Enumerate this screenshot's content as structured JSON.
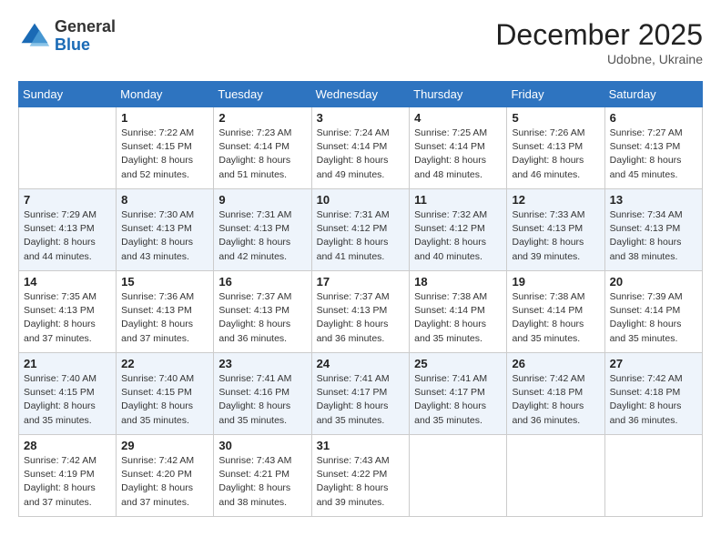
{
  "header": {
    "logo_general": "General",
    "logo_blue": "Blue",
    "month_title": "December 2025",
    "location": "Udobne, Ukraine"
  },
  "days_of_week": [
    "Sunday",
    "Monday",
    "Tuesday",
    "Wednesday",
    "Thursday",
    "Friday",
    "Saturday"
  ],
  "weeks": [
    [
      {
        "day": "",
        "sunrise": "",
        "sunset": "",
        "daylight": ""
      },
      {
        "day": "1",
        "sunrise": "7:22 AM",
        "sunset": "4:15 PM",
        "daylight": "8 hours and 52 minutes."
      },
      {
        "day": "2",
        "sunrise": "7:23 AM",
        "sunset": "4:14 PM",
        "daylight": "8 hours and 51 minutes."
      },
      {
        "day": "3",
        "sunrise": "7:24 AM",
        "sunset": "4:14 PM",
        "daylight": "8 hours and 49 minutes."
      },
      {
        "day": "4",
        "sunrise": "7:25 AM",
        "sunset": "4:14 PM",
        "daylight": "8 hours and 48 minutes."
      },
      {
        "day": "5",
        "sunrise": "7:26 AM",
        "sunset": "4:13 PM",
        "daylight": "8 hours and 46 minutes."
      },
      {
        "day": "6",
        "sunrise": "7:27 AM",
        "sunset": "4:13 PM",
        "daylight": "8 hours and 45 minutes."
      }
    ],
    [
      {
        "day": "7",
        "sunrise": "7:29 AM",
        "sunset": "4:13 PM",
        "daylight": "8 hours and 44 minutes."
      },
      {
        "day": "8",
        "sunrise": "7:30 AM",
        "sunset": "4:13 PM",
        "daylight": "8 hours and 43 minutes."
      },
      {
        "day": "9",
        "sunrise": "7:31 AM",
        "sunset": "4:13 PM",
        "daylight": "8 hours and 42 minutes."
      },
      {
        "day": "10",
        "sunrise": "7:31 AM",
        "sunset": "4:12 PM",
        "daylight": "8 hours and 41 minutes."
      },
      {
        "day": "11",
        "sunrise": "7:32 AM",
        "sunset": "4:12 PM",
        "daylight": "8 hours and 40 minutes."
      },
      {
        "day": "12",
        "sunrise": "7:33 AM",
        "sunset": "4:13 PM",
        "daylight": "8 hours and 39 minutes."
      },
      {
        "day": "13",
        "sunrise": "7:34 AM",
        "sunset": "4:13 PM",
        "daylight": "8 hours and 38 minutes."
      }
    ],
    [
      {
        "day": "14",
        "sunrise": "7:35 AM",
        "sunset": "4:13 PM",
        "daylight": "8 hours and 37 minutes."
      },
      {
        "day": "15",
        "sunrise": "7:36 AM",
        "sunset": "4:13 PM",
        "daylight": "8 hours and 37 minutes."
      },
      {
        "day": "16",
        "sunrise": "7:37 AM",
        "sunset": "4:13 PM",
        "daylight": "8 hours and 36 minutes."
      },
      {
        "day": "17",
        "sunrise": "7:37 AM",
        "sunset": "4:13 PM",
        "daylight": "8 hours and 36 minutes."
      },
      {
        "day": "18",
        "sunrise": "7:38 AM",
        "sunset": "4:14 PM",
        "daylight": "8 hours and 35 minutes."
      },
      {
        "day": "19",
        "sunrise": "7:38 AM",
        "sunset": "4:14 PM",
        "daylight": "8 hours and 35 minutes."
      },
      {
        "day": "20",
        "sunrise": "7:39 AM",
        "sunset": "4:14 PM",
        "daylight": "8 hours and 35 minutes."
      }
    ],
    [
      {
        "day": "21",
        "sunrise": "7:40 AM",
        "sunset": "4:15 PM",
        "daylight": "8 hours and 35 minutes."
      },
      {
        "day": "22",
        "sunrise": "7:40 AM",
        "sunset": "4:15 PM",
        "daylight": "8 hours and 35 minutes."
      },
      {
        "day": "23",
        "sunrise": "7:41 AM",
        "sunset": "4:16 PM",
        "daylight": "8 hours and 35 minutes."
      },
      {
        "day": "24",
        "sunrise": "7:41 AM",
        "sunset": "4:17 PM",
        "daylight": "8 hours and 35 minutes."
      },
      {
        "day": "25",
        "sunrise": "7:41 AM",
        "sunset": "4:17 PM",
        "daylight": "8 hours and 35 minutes."
      },
      {
        "day": "26",
        "sunrise": "7:42 AM",
        "sunset": "4:18 PM",
        "daylight": "8 hours and 36 minutes."
      },
      {
        "day": "27",
        "sunrise": "7:42 AM",
        "sunset": "4:18 PM",
        "daylight": "8 hours and 36 minutes."
      }
    ],
    [
      {
        "day": "28",
        "sunrise": "7:42 AM",
        "sunset": "4:19 PM",
        "daylight": "8 hours and 37 minutes."
      },
      {
        "day": "29",
        "sunrise": "7:42 AM",
        "sunset": "4:20 PM",
        "daylight": "8 hours and 37 minutes."
      },
      {
        "day": "30",
        "sunrise": "7:43 AM",
        "sunset": "4:21 PM",
        "daylight": "8 hours and 38 minutes."
      },
      {
        "day": "31",
        "sunrise": "7:43 AM",
        "sunset": "4:22 PM",
        "daylight": "8 hours and 39 minutes."
      },
      {
        "day": "",
        "sunrise": "",
        "sunset": "",
        "daylight": ""
      },
      {
        "day": "",
        "sunrise": "",
        "sunset": "",
        "daylight": ""
      },
      {
        "day": "",
        "sunrise": "",
        "sunset": "",
        "daylight": ""
      }
    ]
  ],
  "labels": {
    "sunrise": "Sunrise:",
    "sunset": "Sunset:",
    "daylight": "Daylight:"
  }
}
